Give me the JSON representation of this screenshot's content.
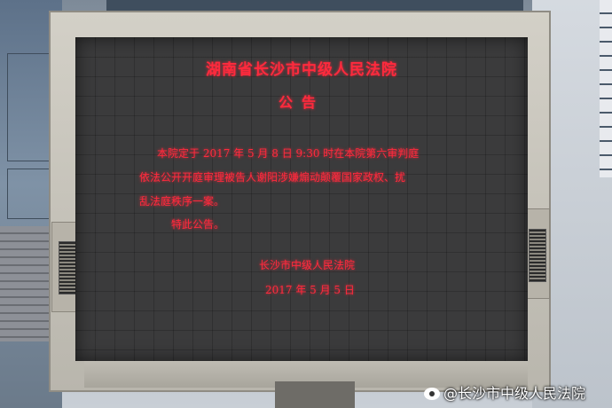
{
  "screen": {
    "title": "湖南省长沙市中级人民法院",
    "heading": "公告",
    "body_lines": [
      "本院定于 2017 年 5 月 8 日 9:30 时在本院第六审判庭",
      "依法公开开庭审理被告人谢阳涉嫌煽动颠覆国家政权、扰",
      "乱法庭秩序一案。",
      "特此公告。"
    ],
    "signature": "长沙市中级人民法院",
    "date": "2017 年 5 月 5 日"
  },
  "watermark": {
    "text": "@长沙市中级人民法院",
    "icon": "weibo-icon"
  },
  "colors": {
    "led_text": "#ff2a3d",
    "screen_bg": "#3b3b3c",
    "frame": "#c9c6bd"
  }
}
